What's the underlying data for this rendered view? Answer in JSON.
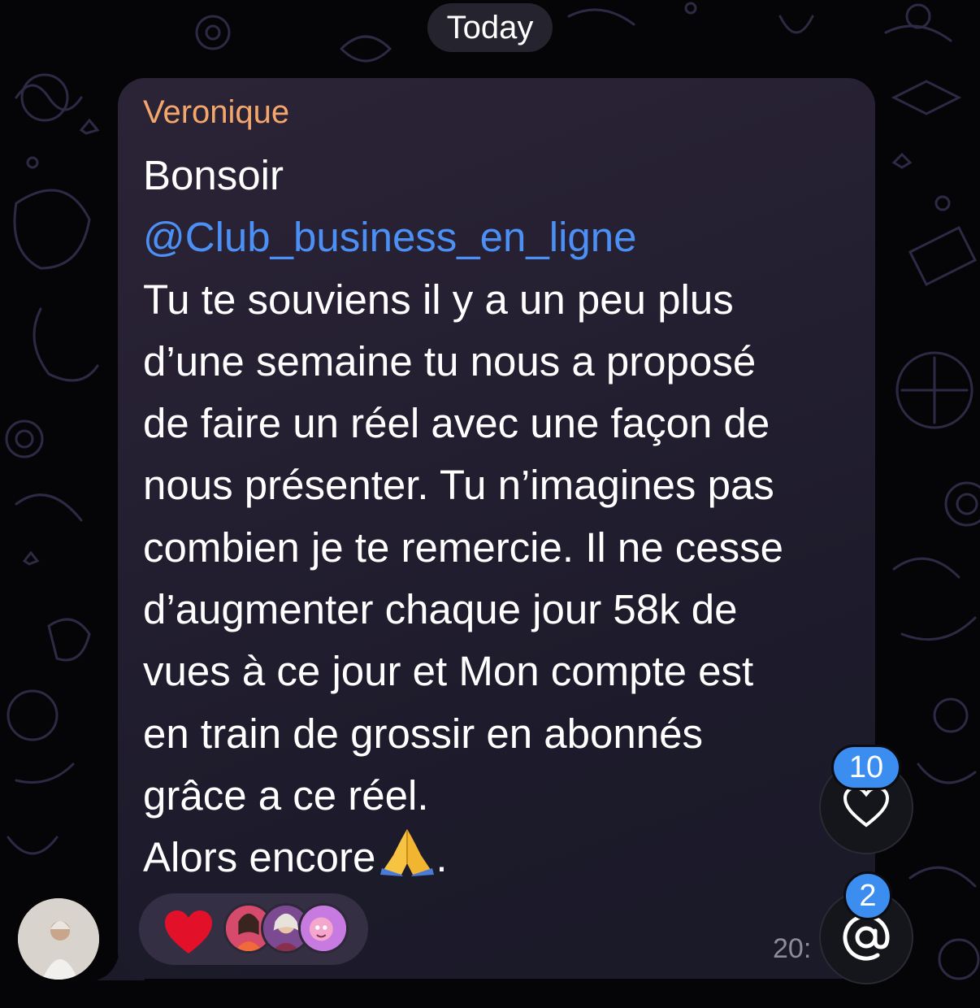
{
  "date_pill": {
    "label": "Today"
  },
  "message": {
    "sender": "Veronique",
    "lines": [
      "Bonsoir",
      "@Club_business_en_ligne",
      "Tu te souviens il y a un peu plus",
      "d’une semaine tu nous a proposé",
      "de faire un réel avec une façon de",
      "nous présenter. Tu n’imagines pas",
      "combien je te remercie. Il ne cesse",
      "d’augmenter chaque jour 58k de",
      "vues à ce jour et Mon compte est",
      "en train de grossir en abonnés",
      "grâce a ce réel.",
      "Alors encore",
      "."
    ],
    "time": "20:",
    "reaction": {
      "emoji": "❤️"
    }
  },
  "reactions_fab": {
    "count": "10",
    "icon": "heart-outline-icon"
  },
  "mentions_fab": {
    "count": "2",
    "icon": "at-icon"
  },
  "colors": {
    "sender": "#f5a66b",
    "mention": "#4d90f5",
    "badge": "#3b8df0"
  }
}
